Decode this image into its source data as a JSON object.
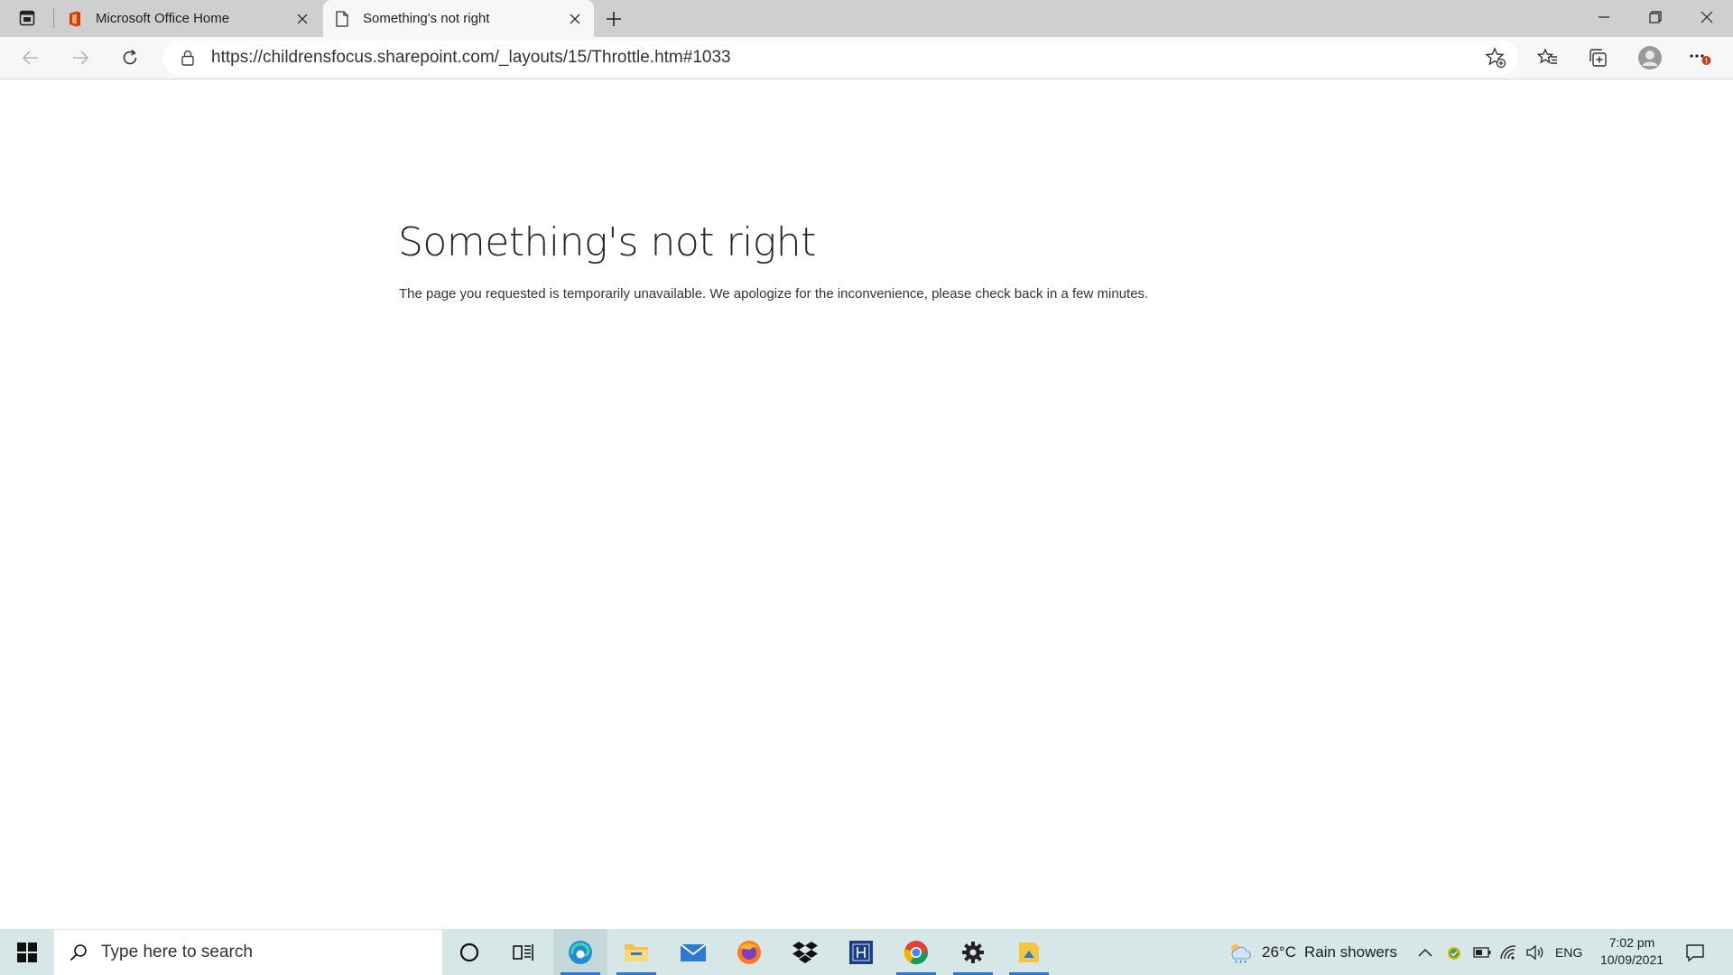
{
  "browser": {
    "tabs": [
      {
        "title": "Microsoft Office Home",
        "icon": "office-icon",
        "active": false
      },
      {
        "title": "Something's not right",
        "icon": "page-icon",
        "active": true
      }
    ],
    "url": "https://childrensfocus.sharepoint.com/_layouts/15/Throttle.htm#1033"
  },
  "page": {
    "heading": "Something's not right",
    "message": "The page you requested is temporarily unavailable. We apologize for the inconvenience, please check back in a few minutes."
  },
  "taskbar": {
    "search_placeholder": "Type here to search",
    "apps": [
      "cortana-icon",
      "task-view-icon",
      "edge-icon",
      "file-explorer-icon",
      "mail-icon",
      "firefox-icon",
      "dropbox-icon",
      "app-icon",
      "chrome-icon",
      "settings-icon",
      "sticky-app-icon"
    ],
    "weather": {
      "temp": "26°C",
      "condition": "Rain showers"
    },
    "language": "ENG",
    "time": "7:02 pm",
    "date": "10/09/2021"
  },
  "colors": {
    "tabstrip": "#cfcfcf",
    "toolbar": "#f7f7f7",
    "taskbar": "#d7e7e8",
    "accent": "#2b7bd6",
    "office_red": "#d83b01"
  }
}
